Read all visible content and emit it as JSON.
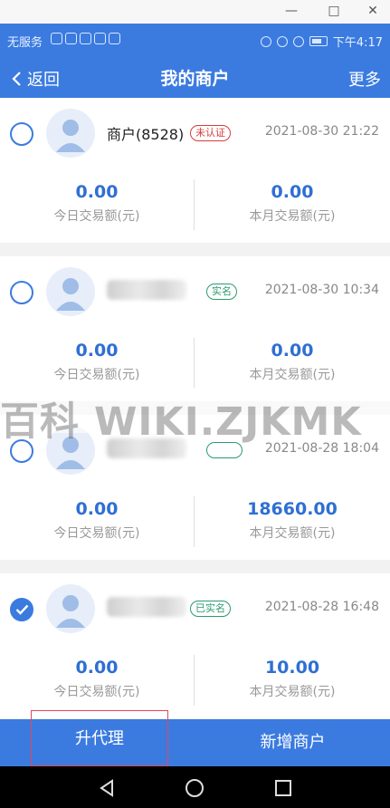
{
  "window": {
    "minimize": "—",
    "maximize": "□",
    "close": "✕"
  },
  "status_bar": {
    "carrier": "无服务",
    "time": "下午4:17"
  },
  "nav": {
    "back": "返回",
    "title": "我的商户",
    "more": "更多"
  },
  "merchants": [
    {
      "name": "商户(8528)",
      "badge": "未认证",
      "badge_color": "#d43d3d",
      "time": "2021-08-30 21:22",
      "today_value": "0.00",
      "month_value": "0.00",
      "checked": false
    },
    {
      "name": "",
      "badge": "实名",
      "badge_color": "#2a9b6f",
      "time": "2021-08-30 10:34",
      "today_value": "0.00",
      "month_value": "0.00",
      "checked": false
    },
    {
      "name": "",
      "badge": "",
      "badge_color": "#2a9b6f",
      "time": "2021-08-28 18:04",
      "today_value": "0.00",
      "month_value": "18660.00",
      "checked": false
    },
    {
      "name": "",
      "badge": "已实名",
      "badge_color": "#2a9b6f",
      "time": "2021-08-28 16:48",
      "today_value": "0.00",
      "month_value": "10.00",
      "checked": true
    }
  ],
  "labels": {
    "today": "今日交易额(元)",
    "month": "本月交易额(元)"
  },
  "watermark": "百科 WIKI.ZJKMK",
  "bottom": {
    "left": "升代理",
    "right": "新增商户"
  },
  "colors": {
    "primary": "#3b7be0",
    "value": "#2f6fd4",
    "warning": "#d43d3d"
  }
}
